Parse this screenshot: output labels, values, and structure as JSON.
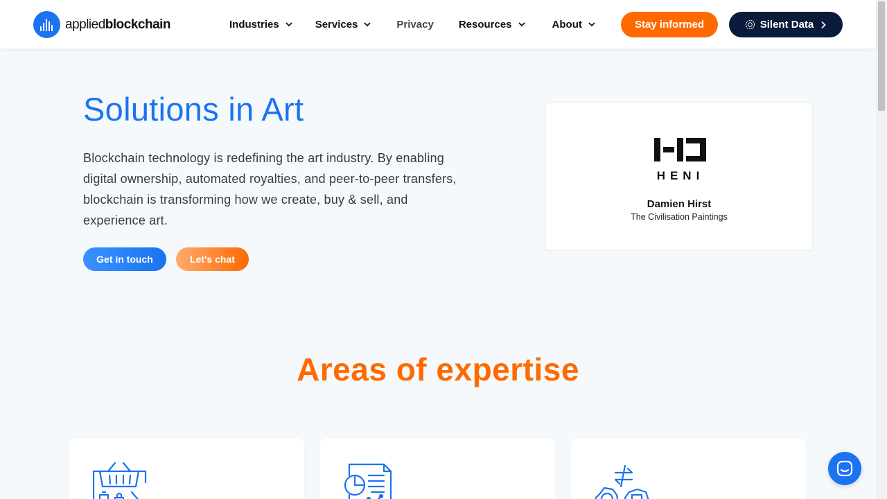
{
  "header": {
    "logo": {
      "text_light": "applied",
      "text_bold": "blockchain"
    },
    "nav": [
      {
        "label": "Industries",
        "dropdown": true
      },
      {
        "label": "Services",
        "dropdown": true
      },
      {
        "label": "Privacy",
        "dropdown": false
      },
      {
        "label": "Resources",
        "dropdown": true
      },
      {
        "label": "About",
        "dropdown": true
      }
    ],
    "stay_informed": "Stay informed",
    "silent_data": "Silent Data"
  },
  "hero": {
    "title": "Solutions in Art",
    "text": "Blockchain technology is redefining the art industry. By enabling digital ownership, automated royalties, and peer-to-peer transfers, blockchain is transforming how we create, buy & sell, and experience art.",
    "cta_primary": "Get in touch",
    "cta_secondary": "Let's chat"
  },
  "client": {
    "logo_text": "HENI",
    "name": "Damien Hirst",
    "project": "The Civilisation Paintings"
  },
  "expertise": {
    "title": "Areas of expertise",
    "cards": [
      {
        "icon": "shopping-basket-icon"
      },
      {
        "icon": "document-chart-icon"
      },
      {
        "icon": "exchange-gears-icon"
      }
    ]
  },
  "colors": {
    "brand_blue": "#1a73f0",
    "brand_orange": "#ff6a00",
    "navy": "#0a1a3a",
    "background": "#f5f9fc"
  }
}
